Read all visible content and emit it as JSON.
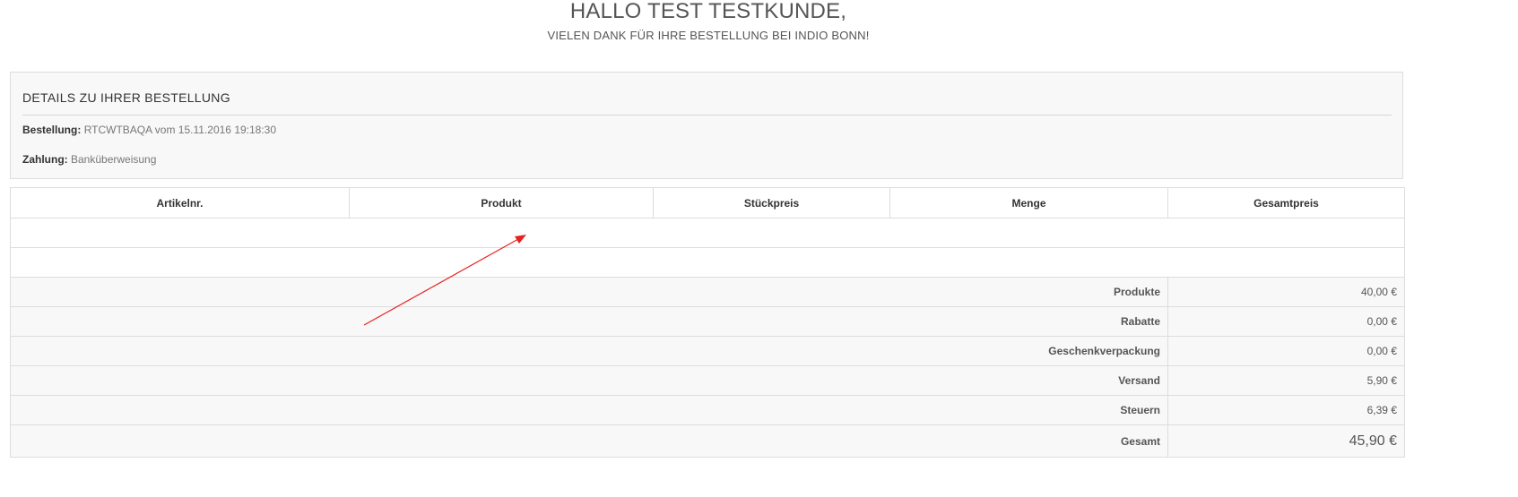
{
  "header": {
    "greeting": "HALLO TEST TESTKUNDE,",
    "subtitle": "VIELEN DANK FÜR IHRE BESTELLUNG BEI INDIO BONN!"
  },
  "details": {
    "title": "DETAILS ZU IHRER BESTELLUNG",
    "order_label": "Bestellung:",
    "order_value": "RTCWTBAQA vom 15.11.2016 19:18:30",
    "payment_label": "Zahlung:",
    "payment_value": "Banküberweisung"
  },
  "table": {
    "columns": [
      "Artikelnr.",
      "Produkt",
      "Stückpreis",
      "Menge",
      "Gesamtpreis"
    ],
    "summary": [
      {
        "label": "Produkte",
        "value": "40,00 €"
      },
      {
        "label": "Rabatte",
        "value": "0,00 €"
      },
      {
        "label": "Geschenkverpackung",
        "value": "0,00 €"
      },
      {
        "label": "Versand",
        "value": "5,90 €"
      },
      {
        "label": "Steuern",
        "value": "6,39 €"
      },
      {
        "label": "Gesamt",
        "value": "45,90 €"
      }
    ]
  },
  "annotation": {
    "arrow_color": "#e8211f"
  }
}
